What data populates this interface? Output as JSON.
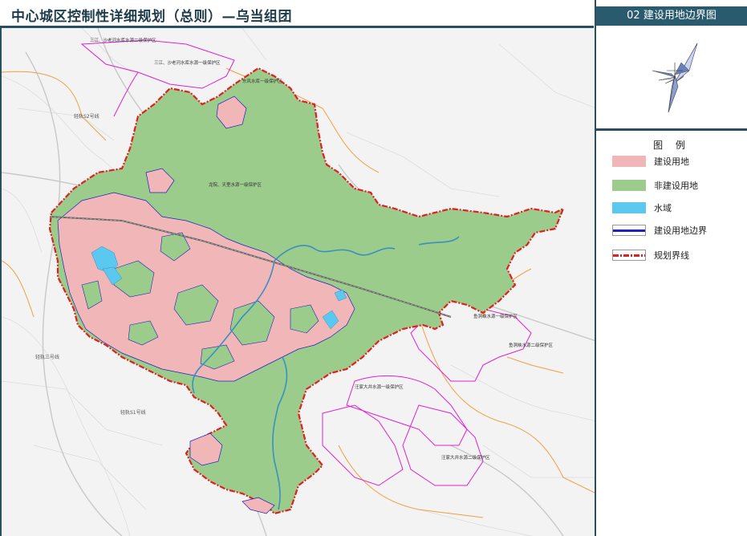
{
  "header": {
    "title": "中心城区控制性详细规划（总则）—乌当组团"
  },
  "sidebar": {
    "panel_title": "02 建设用地边界图"
  },
  "legend": {
    "title": "图 例",
    "items": [
      {
        "label": "建设用地",
        "color": "#f0b6b8"
      },
      {
        "label": "非建设用地",
        "color": "#9ccc8c"
      },
      {
        "label": "水域",
        "color": "#5bc8f0"
      },
      {
        "label": "建设用地边界",
        "color": "#2020c0"
      },
      {
        "label": "规划界线",
        "color": "#e02020"
      }
    ]
  },
  "map_labels": {
    "zone1": "三江、沙老河水库水源二级保护区",
    "zone2": "三江、沙老河水库水源一级保护区",
    "zone3": "东风水库一级保护区",
    "zone4": "龙院、天里水源一级保护区",
    "zone5": "鱼洞峡水源一级保护区",
    "zone6": "鱼洞峡水源二级保护区",
    "zone7": "汪家大井水源一级保护区",
    "zone8": "汪家大井水源二级保护区",
    "road1": "轻轨S2号线",
    "road2": "轻轨三号线",
    "road3": "轻轨S1号线"
  }
}
